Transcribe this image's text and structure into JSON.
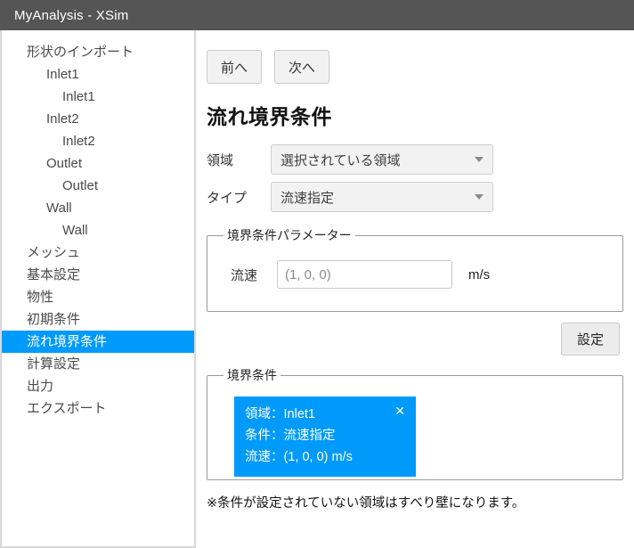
{
  "window": {
    "title": "MyAnalysis - XSim"
  },
  "sidebar": {
    "items": [
      {
        "label": "形状のインポート",
        "level": 0,
        "selected": false
      },
      {
        "label": "Inlet1",
        "level": 1,
        "selected": false
      },
      {
        "label": "Inlet1",
        "level": 2,
        "selected": false
      },
      {
        "label": "Inlet2",
        "level": 1,
        "selected": false
      },
      {
        "label": "Inlet2",
        "level": 2,
        "selected": false
      },
      {
        "label": "Outlet",
        "level": 1,
        "selected": false
      },
      {
        "label": "Outlet",
        "level": 2,
        "selected": false
      },
      {
        "label": "Wall",
        "level": 1,
        "selected": false
      },
      {
        "label": "Wall",
        "level": 2,
        "selected": false
      },
      {
        "label": "メッシュ",
        "level": 0,
        "selected": false
      },
      {
        "label": "基本設定",
        "level": 0,
        "selected": false
      },
      {
        "label": "物性",
        "level": 0,
        "selected": false
      },
      {
        "label": "初期条件",
        "level": 0,
        "selected": false
      },
      {
        "label": "流れ境界条件",
        "level": 0,
        "selected": true
      },
      {
        "label": "計算設定",
        "level": 0,
        "selected": false
      },
      {
        "label": "出力",
        "level": 0,
        "selected": false
      },
      {
        "label": "エクスポート",
        "level": 0,
        "selected": false
      }
    ]
  },
  "toolbar": {
    "prev_label": "前へ",
    "next_label": "次へ"
  },
  "main": {
    "page_title": "流れ境界条件",
    "region": {
      "label": "領域",
      "value": "選択されている領域"
    },
    "type": {
      "label": "タイプ",
      "value": "流速指定"
    },
    "param_panel": {
      "legend": "境界条件パラメーター",
      "velocity_label": "流速",
      "velocity_value": "(1, 0, 0)",
      "velocity_unit": "m/s"
    },
    "apply_label": "設定",
    "bc_panel": {
      "legend": "境界条件",
      "cards": [
        {
          "line1": "領域：Inlet1",
          "line2": "条件：流速指定",
          "line3": "流速：(1, 0, 0) m/s",
          "close_glyph": "✕"
        }
      ]
    },
    "note": "※条件が設定されていない領域はすべり壁になります。"
  },
  "colors": {
    "titlebar": "#555555",
    "accent": "#009afb",
    "panel_border": "#9a9a9a"
  }
}
